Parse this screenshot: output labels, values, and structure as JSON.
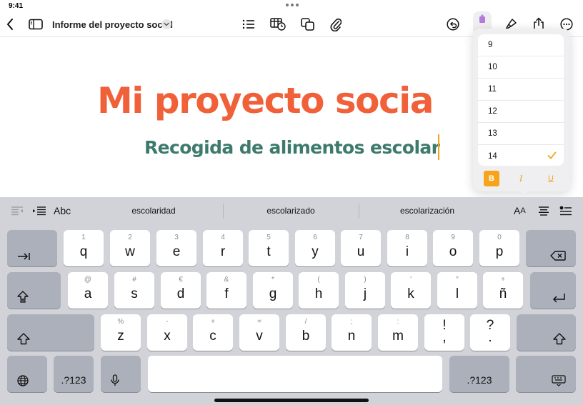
{
  "status": {
    "time": "9:41"
  },
  "toolbar": {
    "doc_title": "Informe del proyecto social",
    "icons": [
      "back-chevron-icon",
      "sidebar-icon",
      "title-dropdown-icon",
      "list-icon",
      "table-icon",
      "shapes-icon",
      "attachment-icon",
      "undo-icon",
      "format-brush-icon",
      "brush-icon",
      "share-icon",
      "more-icon"
    ]
  },
  "document": {
    "heading": "Mi proyecto socia",
    "subheading": "Recogida de alimentos escolar"
  },
  "font_size_popover": {
    "sizes": [
      "9",
      "10",
      "11",
      "12",
      "13",
      "14"
    ],
    "selected": "14",
    "bold_label": "B",
    "italic_label": "I",
    "underline_label": "U"
  },
  "keyboard": {
    "abc_label": "Abc",
    "suggestions": [
      "escolaridad",
      "escolarizado",
      "escolarización"
    ],
    "aa_big": "A",
    "aa_small": "A",
    "row1": [
      {
        "alt": "1",
        "main": "q"
      },
      {
        "alt": "2",
        "main": "w"
      },
      {
        "alt": "3",
        "main": "e"
      },
      {
        "alt": "4",
        "main": "r"
      },
      {
        "alt": "5",
        "main": "t"
      },
      {
        "alt": "6",
        "main": "y"
      },
      {
        "alt": "7",
        "main": "u"
      },
      {
        "alt": "8",
        "main": "i"
      },
      {
        "alt": "9",
        "main": "o"
      },
      {
        "alt": "0",
        "main": "p"
      }
    ],
    "row2": [
      {
        "alt": "@",
        "main": "a"
      },
      {
        "alt": "#",
        "main": "s"
      },
      {
        "alt": "€",
        "main": "d"
      },
      {
        "alt": "&",
        "main": "f"
      },
      {
        "alt": "*",
        "main": "g"
      },
      {
        "alt": "(",
        "main": "h"
      },
      {
        "alt": ")",
        "main": "j"
      },
      {
        "alt": "′",
        "main": "k"
      },
      {
        "alt": "″",
        "main": "l"
      },
      {
        "alt": "+",
        "main": "ñ"
      }
    ],
    "row3": [
      {
        "alt": "%",
        "main": "z"
      },
      {
        "alt": "-",
        "main": "x"
      },
      {
        "alt": "+",
        "main": "c"
      },
      {
        "alt": "=",
        "main": "v"
      },
      {
        "alt": "/",
        "main": "b"
      },
      {
        "alt": ";",
        "main": "n"
      },
      {
        "alt": ":",
        "main": "m"
      }
    ],
    "punct1": {
      "top": "!",
      "bottom": ","
    },
    "punct2": {
      "top": "?",
      "bottom": "."
    },
    "numbers_label": ".?123"
  },
  "colors": {
    "heading": "#f0613a",
    "subheading": "#3d7a6c",
    "accent": "#f7a41c"
  }
}
